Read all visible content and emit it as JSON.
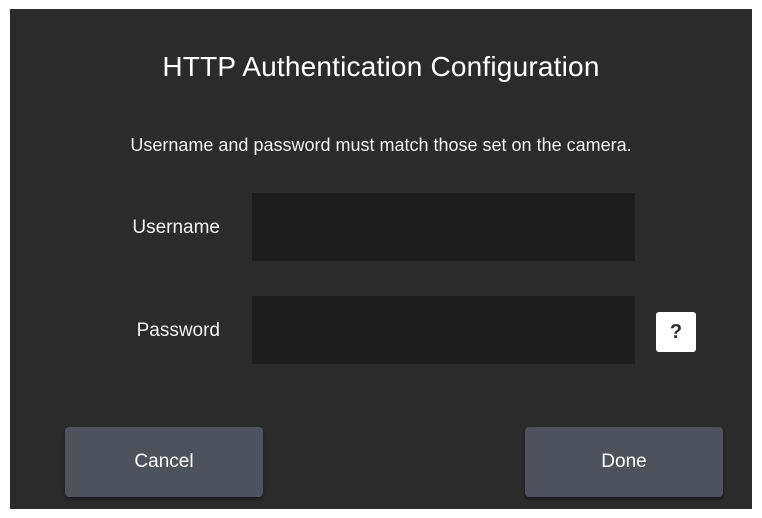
{
  "dialog": {
    "title": "HTTP Authentication Configuration",
    "description": "Username and password must match those set on the camera.",
    "username": {
      "label": "Username",
      "value": "",
      "placeholder": ""
    },
    "password": {
      "label": "Password",
      "value": "",
      "placeholder": ""
    },
    "help_label": "?",
    "cancel_label": "Cancel",
    "done_label": "Done"
  },
  "colors": {
    "dialog_background": "#2b2b2b",
    "input_background": "#1c1c1c",
    "button_background": "#4d525c",
    "text": "#ffffff"
  },
  "icons": {
    "help": "question-mark-icon"
  }
}
